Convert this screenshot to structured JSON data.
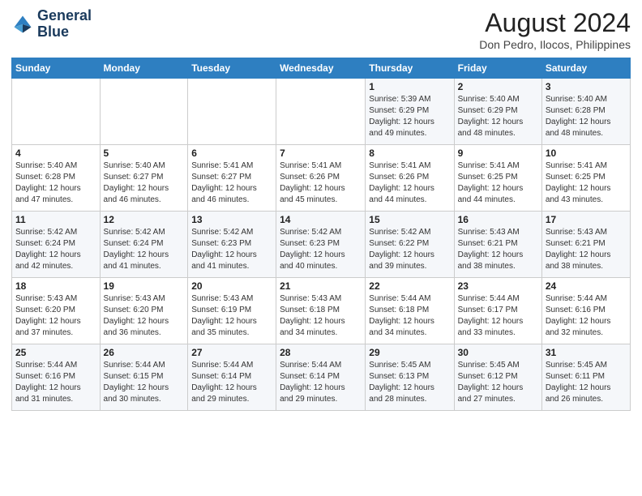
{
  "header": {
    "logo_line1": "General",
    "logo_line2": "Blue",
    "month_title": "August 2024",
    "location": "Don Pedro, Ilocos, Philippines"
  },
  "weekdays": [
    "Sunday",
    "Monday",
    "Tuesday",
    "Wednesday",
    "Thursday",
    "Friday",
    "Saturday"
  ],
  "weeks": [
    [
      {
        "day": "",
        "info": ""
      },
      {
        "day": "",
        "info": ""
      },
      {
        "day": "",
        "info": ""
      },
      {
        "day": "",
        "info": ""
      },
      {
        "day": "1",
        "info": "Sunrise: 5:39 AM\nSunset: 6:29 PM\nDaylight: 12 hours\nand 49 minutes."
      },
      {
        "day": "2",
        "info": "Sunrise: 5:40 AM\nSunset: 6:29 PM\nDaylight: 12 hours\nand 48 minutes."
      },
      {
        "day": "3",
        "info": "Sunrise: 5:40 AM\nSunset: 6:28 PM\nDaylight: 12 hours\nand 48 minutes."
      }
    ],
    [
      {
        "day": "4",
        "info": "Sunrise: 5:40 AM\nSunset: 6:28 PM\nDaylight: 12 hours\nand 47 minutes."
      },
      {
        "day": "5",
        "info": "Sunrise: 5:40 AM\nSunset: 6:27 PM\nDaylight: 12 hours\nand 46 minutes."
      },
      {
        "day": "6",
        "info": "Sunrise: 5:41 AM\nSunset: 6:27 PM\nDaylight: 12 hours\nand 46 minutes."
      },
      {
        "day": "7",
        "info": "Sunrise: 5:41 AM\nSunset: 6:26 PM\nDaylight: 12 hours\nand 45 minutes."
      },
      {
        "day": "8",
        "info": "Sunrise: 5:41 AM\nSunset: 6:26 PM\nDaylight: 12 hours\nand 44 minutes."
      },
      {
        "day": "9",
        "info": "Sunrise: 5:41 AM\nSunset: 6:25 PM\nDaylight: 12 hours\nand 44 minutes."
      },
      {
        "day": "10",
        "info": "Sunrise: 5:41 AM\nSunset: 6:25 PM\nDaylight: 12 hours\nand 43 minutes."
      }
    ],
    [
      {
        "day": "11",
        "info": "Sunrise: 5:42 AM\nSunset: 6:24 PM\nDaylight: 12 hours\nand 42 minutes."
      },
      {
        "day": "12",
        "info": "Sunrise: 5:42 AM\nSunset: 6:24 PM\nDaylight: 12 hours\nand 41 minutes."
      },
      {
        "day": "13",
        "info": "Sunrise: 5:42 AM\nSunset: 6:23 PM\nDaylight: 12 hours\nand 41 minutes."
      },
      {
        "day": "14",
        "info": "Sunrise: 5:42 AM\nSunset: 6:23 PM\nDaylight: 12 hours\nand 40 minutes."
      },
      {
        "day": "15",
        "info": "Sunrise: 5:42 AM\nSunset: 6:22 PM\nDaylight: 12 hours\nand 39 minutes."
      },
      {
        "day": "16",
        "info": "Sunrise: 5:43 AM\nSunset: 6:21 PM\nDaylight: 12 hours\nand 38 minutes."
      },
      {
        "day": "17",
        "info": "Sunrise: 5:43 AM\nSunset: 6:21 PM\nDaylight: 12 hours\nand 38 minutes."
      }
    ],
    [
      {
        "day": "18",
        "info": "Sunrise: 5:43 AM\nSunset: 6:20 PM\nDaylight: 12 hours\nand 37 minutes."
      },
      {
        "day": "19",
        "info": "Sunrise: 5:43 AM\nSunset: 6:20 PM\nDaylight: 12 hours\nand 36 minutes."
      },
      {
        "day": "20",
        "info": "Sunrise: 5:43 AM\nSunset: 6:19 PM\nDaylight: 12 hours\nand 35 minutes."
      },
      {
        "day": "21",
        "info": "Sunrise: 5:43 AM\nSunset: 6:18 PM\nDaylight: 12 hours\nand 34 minutes."
      },
      {
        "day": "22",
        "info": "Sunrise: 5:44 AM\nSunset: 6:18 PM\nDaylight: 12 hours\nand 34 minutes."
      },
      {
        "day": "23",
        "info": "Sunrise: 5:44 AM\nSunset: 6:17 PM\nDaylight: 12 hours\nand 33 minutes."
      },
      {
        "day": "24",
        "info": "Sunrise: 5:44 AM\nSunset: 6:16 PM\nDaylight: 12 hours\nand 32 minutes."
      }
    ],
    [
      {
        "day": "25",
        "info": "Sunrise: 5:44 AM\nSunset: 6:16 PM\nDaylight: 12 hours\nand 31 minutes."
      },
      {
        "day": "26",
        "info": "Sunrise: 5:44 AM\nSunset: 6:15 PM\nDaylight: 12 hours\nand 30 minutes."
      },
      {
        "day": "27",
        "info": "Sunrise: 5:44 AM\nSunset: 6:14 PM\nDaylight: 12 hours\nand 29 minutes."
      },
      {
        "day": "28",
        "info": "Sunrise: 5:44 AM\nSunset: 6:14 PM\nDaylight: 12 hours\nand 29 minutes."
      },
      {
        "day": "29",
        "info": "Sunrise: 5:45 AM\nSunset: 6:13 PM\nDaylight: 12 hours\nand 28 minutes."
      },
      {
        "day": "30",
        "info": "Sunrise: 5:45 AM\nSunset: 6:12 PM\nDaylight: 12 hours\nand 27 minutes."
      },
      {
        "day": "31",
        "info": "Sunrise: 5:45 AM\nSunset: 6:11 PM\nDaylight: 12 hours\nand 26 minutes."
      }
    ]
  ]
}
